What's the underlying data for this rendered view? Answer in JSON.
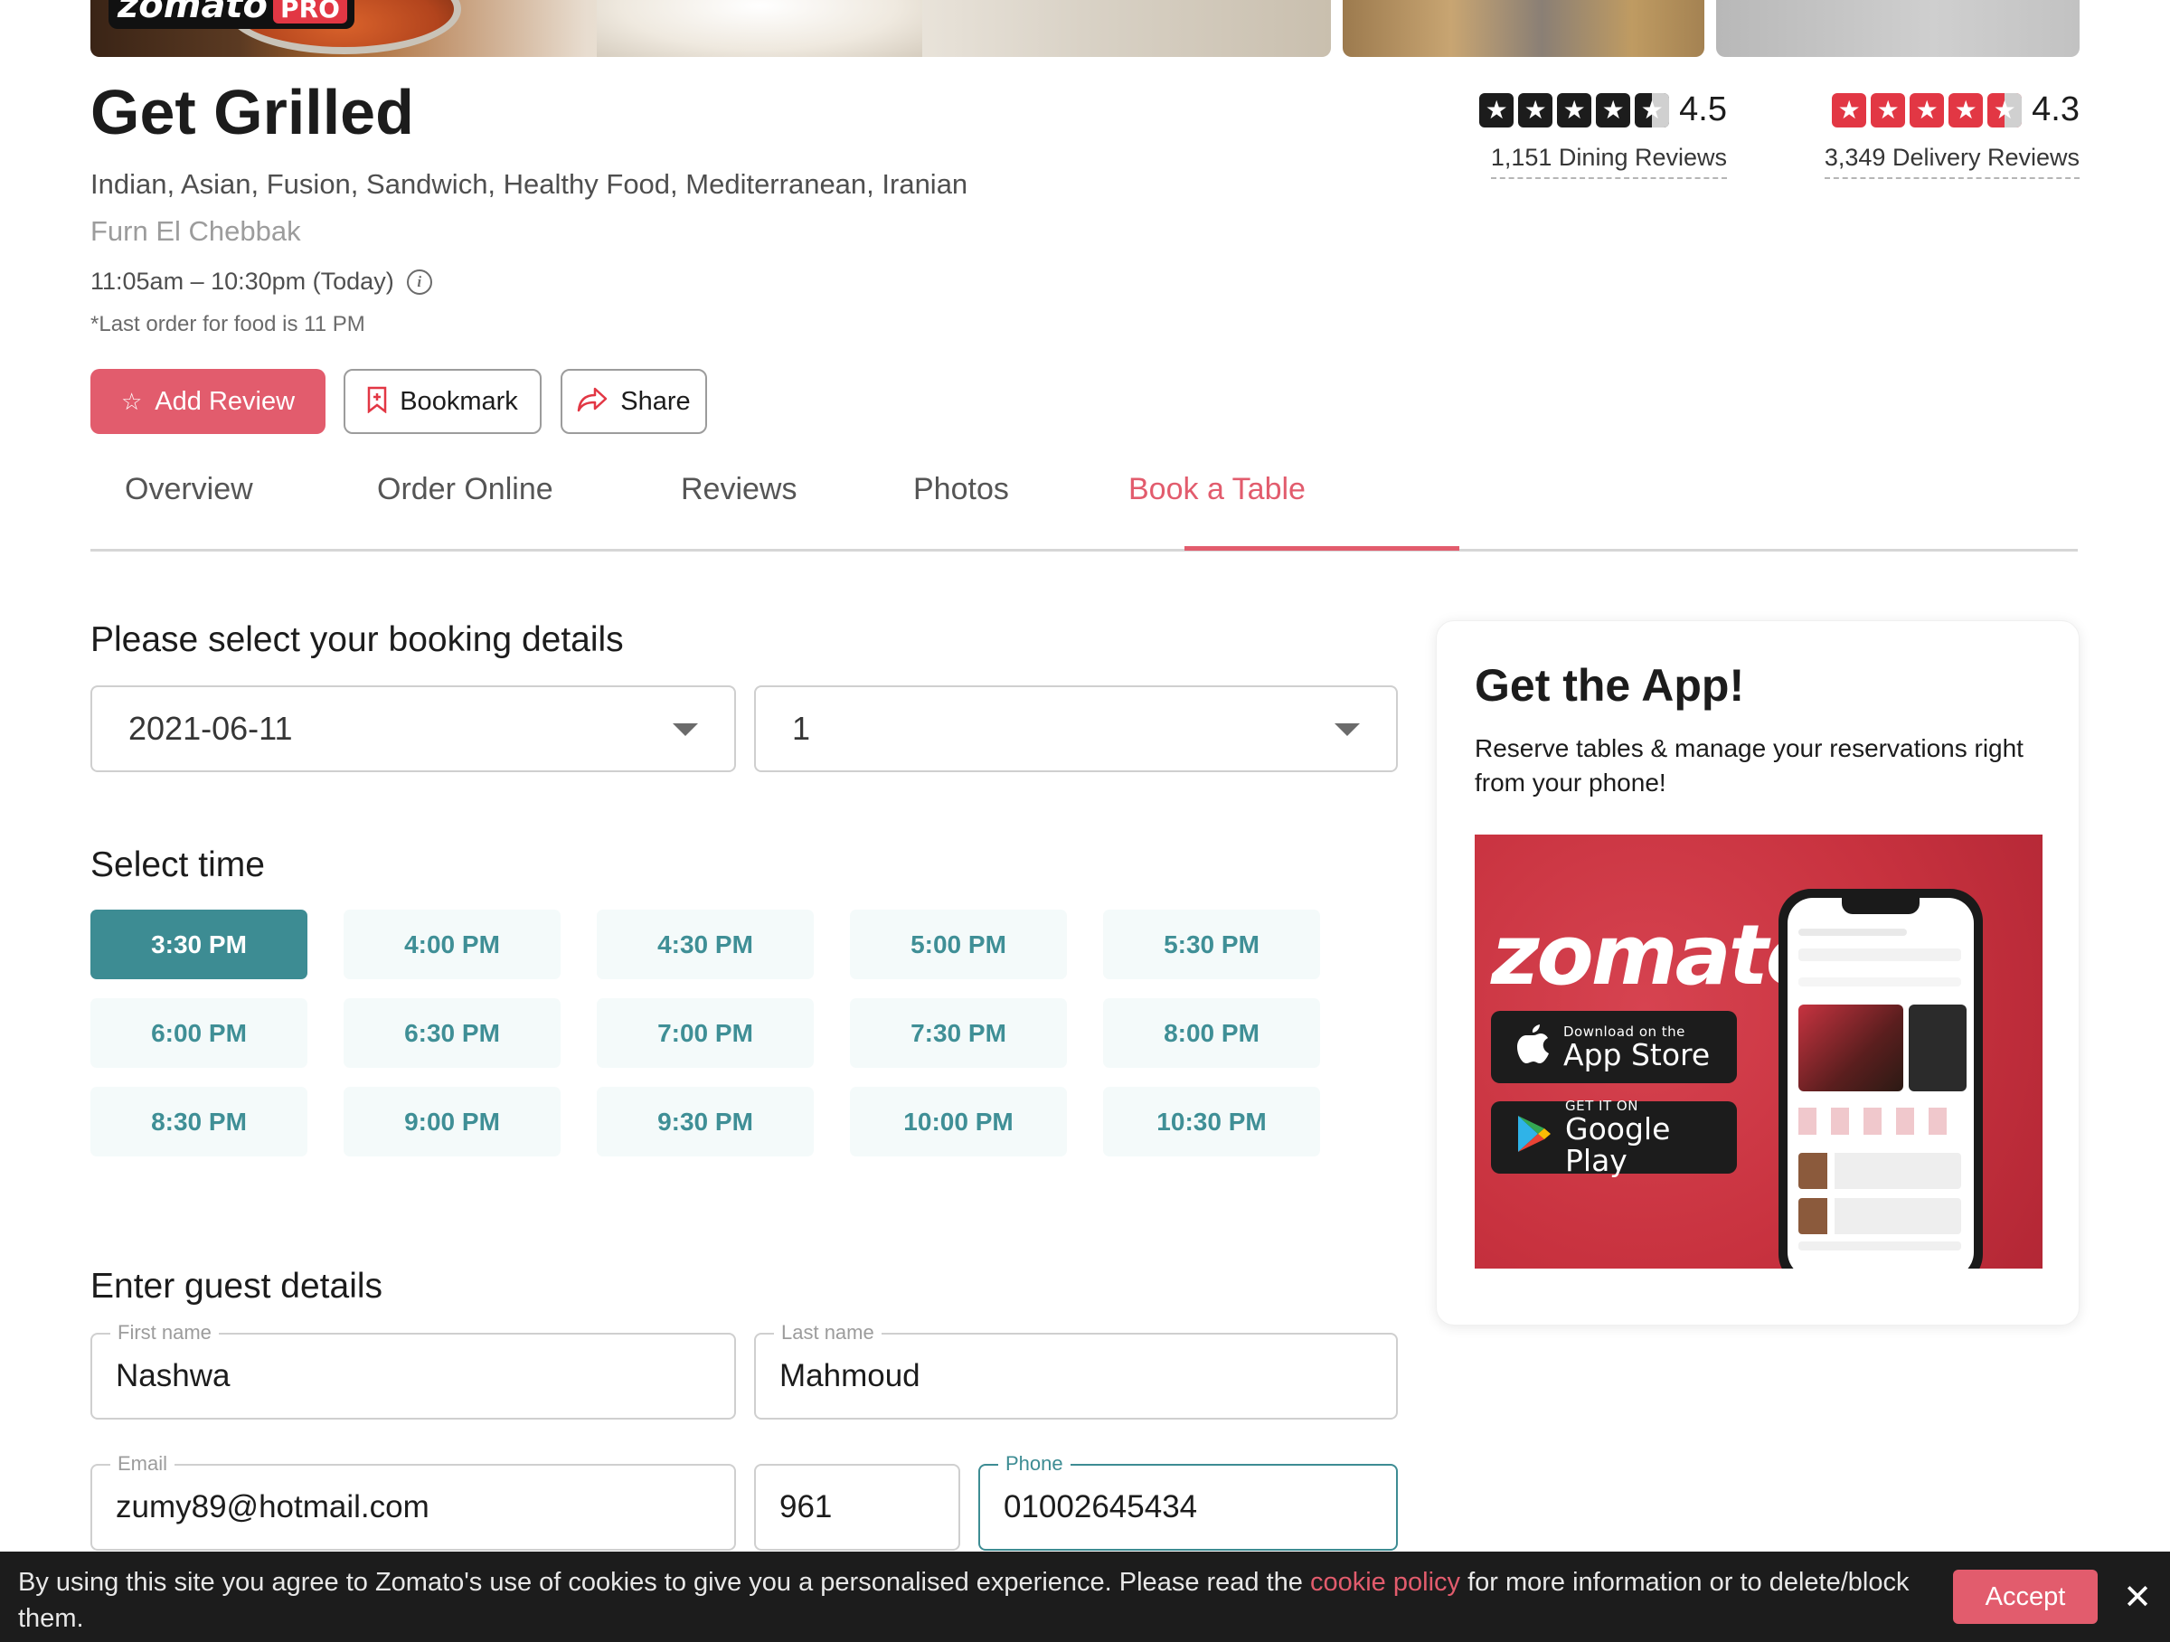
{
  "restaurant": {
    "name": "Get Grilled",
    "cuisines": "Indian, Asian, Fusion, Sandwich, Healthy Food, Mediterranean, Iranian",
    "locality": "Furn El Chebbak",
    "timing": "11:05am – 10:30pm (Today)",
    "last_order": "*Last order for food is 11 PM",
    "hero_logo": {
      "brand": "zomato",
      "badge": "PRO"
    }
  },
  "ratings": {
    "dining": {
      "value": "4.5",
      "label": "1,151 Dining Reviews",
      "color": "#1c1c1c"
    },
    "delivery": {
      "value": "4.3",
      "label": "3,349 Delivery Reviews",
      "color": "#e23744"
    }
  },
  "actions": {
    "add_review": "Add Review",
    "bookmark": "Bookmark",
    "share": "Share"
  },
  "tabs": [
    {
      "label": "Overview",
      "active": false
    },
    {
      "label": "Order Online",
      "active": false
    },
    {
      "label": "Reviews",
      "active": false
    },
    {
      "label": "Photos",
      "active": false
    },
    {
      "label": "Book a Table",
      "active": true
    }
  ],
  "booking": {
    "heading": "Please select your booking details",
    "date": "2021-06-11",
    "guests": "1",
    "time_heading": "Select time",
    "selected_time": "3:30 PM",
    "time_slots": [
      "3:30 PM",
      "4:00 PM",
      "4:30 PM",
      "5:00 PM",
      "5:30 PM",
      "6:00 PM",
      "6:30 PM",
      "7:00 PM",
      "7:30 PM",
      "8:00 PM",
      "8:30 PM",
      "9:00 PM",
      "9:30 PM",
      "10:00 PM",
      "10:30 PM"
    ]
  },
  "guest": {
    "heading": "Enter guest details",
    "first_name": {
      "label": "First name",
      "value": "Nashwa"
    },
    "last_name": {
      "label": "Last name",
      "value": "Mahmoud"
    },
    "email": {
      "label": "Email",
      "value": "zumy89@hotmail.com"
    },
    "country_code": {
      "value": "961"
    },
    "phone": {
      "label": "Phone",
      "value": "01002645434"
    }
  },
  "app_promo": {
    "title": "Get the App!",
    "description": "Reserve tables & manage your reservations right from your phone!",
    "banner_brand": "zomato",
    "app_store": {
      "small": "Download on the",
      "big": "App Store"
    },
    "google_play": {
      "small": "GET IT ON",
      "big": "Google Play"
    }
  },
  "cookie_bar": {
    "text_before": "By using this site you agree to Zomato's use of cookies to give you a personalised experience. Please read the ",
    "link": "cookie policy",
    "text_after": " for more information or to delete/block them.",
    "accept": "Accept"
  },
  "colors": {
    "accent": "#e25c6d",
    "teal": "#3d8c93",
    "slot_bg": "#f4fafa"
  },
  "icons": {
    "info": "info-icon",
    "add_review": "star-outline-icon",
    "bookmark": "bookmark-icon",
    "share": "share-icon",
    "caret": "caret-down-icon",
    "close": "close-icon"
  }
}
